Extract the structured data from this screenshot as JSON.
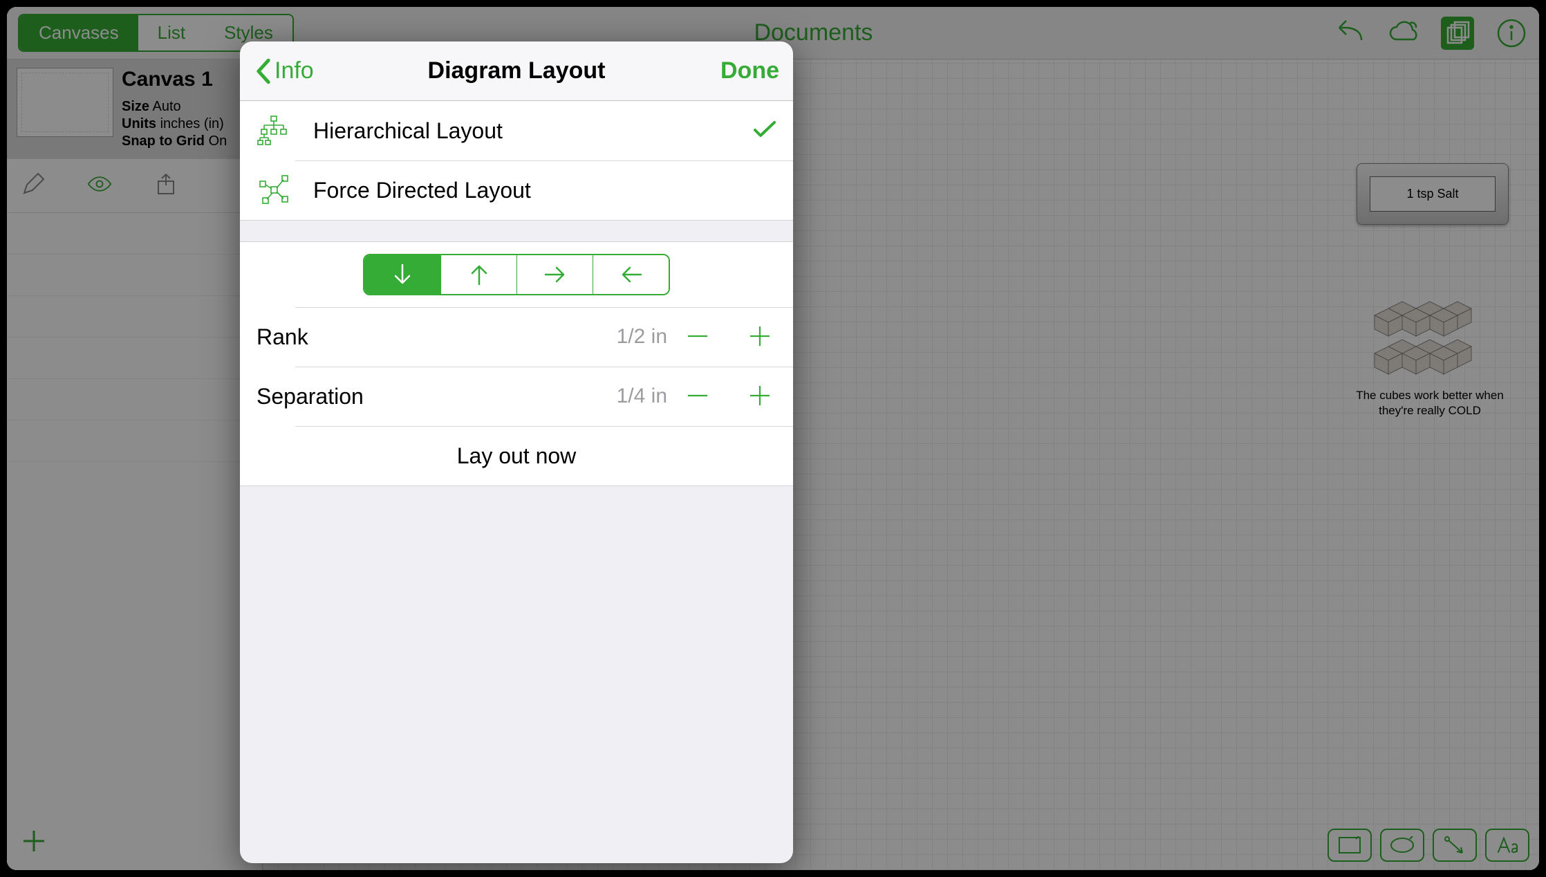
{
  "toolbar": {
    "tabs": [
      "Canvases",
      "List",
      "Styles"
    ],
    "documents_title": "Documents"
  },
  "sidebar": {
    "canvas_title": "Canvas 1",
    "size_label": "Size",
    "size_value": "Auto",
    "units_label": "Units",
    "units_value": "inches (in)",
    "snap_label": "Snap to Grid",
    "snap_value": "On"
  },
  "canvas": {
    "node_text": "1 tsp Salt",
    "caption": "The cubes work better when they're really COLD"
  },
  "popover": {
    "back": "Info",
    "title": "Diagram Layout",
    "done": "Done",
    "layouts": {
      "hierarchical": "Hierarchical Layout",
      "force": "Force Directed Layout"
    },
    "rank": {
      "label": "Rank",
      "value": "1/2 in"
    },
    "separation": {
      "label": "Separation",
      "value": "1/4 in"
    },
    "action": "Lay out now"
  }
}
